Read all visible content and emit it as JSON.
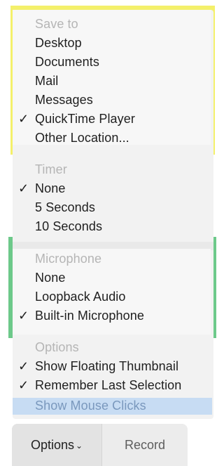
{
  "menu": {
    "save_to": {
      "header": "Save to",
      "items": [
        {
          "label": "Desktop",
          "checked": false
        },
        {
          "label": "Documents",
          "checked": false
        },
        {
          "label": "Mail",
          "checked": false
        },
        {
          "label": "Messages",
          "checked": false
        },
        {
          "label": "QuickTime Player",
          "checked": true
        },
        {
          "label": "Other Location...",
          "checked": false
        }
      ]
    },
    "timer": {
      "header": "Timer",
      "items": [
        {
          "label": "None",
          "checked": true
        },
        {
          "label": "5 Seconds",
          "checked": false
        },
        {
          "label": "10 Seconds",
          "checked": false
        }
      ]
    },
    "microphone": {
      "header": "Microphone",
      "items": [
        {
          "label": "None",
          "checked": false
        },
        {
          "label": "Loopback Audio",
          "checked": false
        },
        {
          "label": "Built-in Microphone",
          "checked": true
        }
      ]
    },
    "options": {
      "header": "Options",
      "items": [
        {
          "label": "Show Floating Thumbnail",
          "checked": true
        },
        {
          "label": "Remember Last Selection",
          "checked": true
        },
        {
          "label": "Show Mouse Clicks",
          "checked": false,
          "highlighted": true
        }
      ]
    },
    "check_glyph": "✓"
  },
  "toolbar": {
    "options_label": "Options",
    "chevron": "⌄",
    "record_label": "Record"
  },
  "colors": {
    "highlight_yellow": "#f4f06a",
    "highlight_green": "#6dc98a",
    "selection_blue": "#c7dcf3"
  }
}
